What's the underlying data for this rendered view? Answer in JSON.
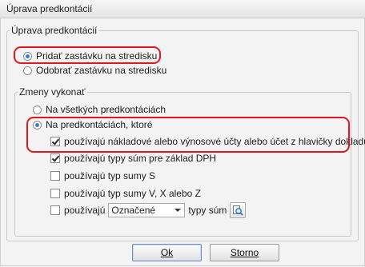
{
  "window": {
    "title": "Úprava predkontácií"
  },
  "main_group": {
    "legend": "Úprava predkontácií"
  },
  "action": {
    "options": [
      {
        "label": "Pridať zastávku na stredisku",
        "selected": true
      },
      {
        "label": "Odobrať zastávku na stredisku",
        "selected": false
      }
    ]
  },
  "changes_group": {
    "legend": "Zmeny vykonať",
    "scope_options": [
      {
        "label": "Na všetkých predkontáciách",
        "selected": false
      },
      {
        "label": "Na predkontáciách, ktoré",
        "selected": true
      }
    ],
    "conditions": [
      {
        "label": "používajú nákladové alebo výnosové účty alebo účet z hlavičky dokladu",
        "checked": true
      },
      {
        "label": "používajú typy súm pre základ DPH",
        "checked": true
      },
      {
        "label": "používajú typ sumy S",
        "checked": false
      },
      {
        "label": "používajú typ sumy V, X alebo Z",
        "checked": false
      }
    ],
    "sum_types_filter": {
      "prefix": "používajú",
      "select_value": "Označené",
      "suffix": "typy súm",
      "checked": false
    }
  },
  "buttons": {
    "ok": "Ok",
    "cancel": "Storno"
  },
  "highlight_color": "#e3161d"
}
